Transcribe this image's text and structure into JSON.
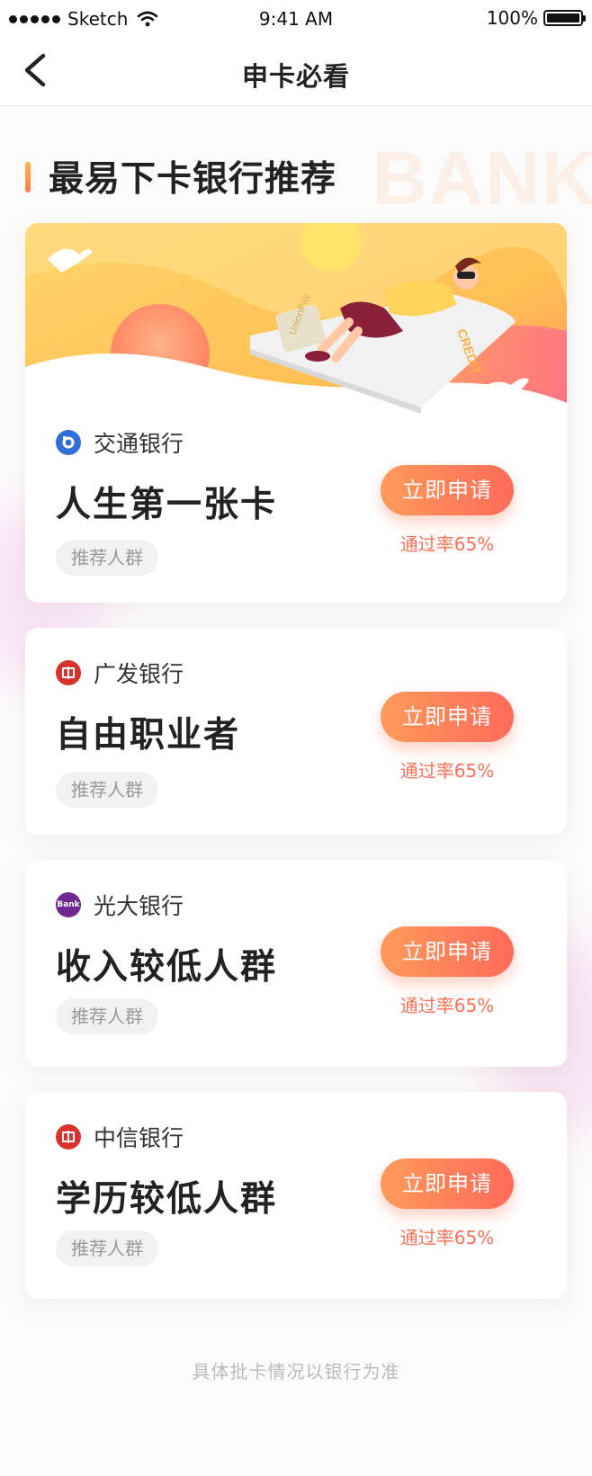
{
  "status_bar": {
    "carrier": "Sketch",
    "time": "9:41 AM",
    "battery": "100%"
  },
  "nav": {
    "title": "申卡必看"
  },
  "section": {
    "title": "最易下卡银行推荐",
    "watermark": "BANK"
  },
  "banner": {
    "card_text": "CREDIT",
    "union_text": "UnionPay"
  },
  "cards": [
    {
      "bank": "交通银行",
      "title": "人生第一张卡",
      "tag": "推荐人群",
      "button": "立即申请",
      "rate": "通过率65%",
      "logo_color": "#2f6fd8"
    },
    {
      "bank": "广发银行",
      "title": "自由职业者",
      "tag": "推荐人群",
      "button": "立即申请",
      "rate": "通过率65%",
      "logo_color": "#d9312b"
    },
    {
      "bank": "光大银行",
      "title": "收入较低人群",
      "tag": "推荐人群",
      "button": "立即申请",
      "rate": "通过率65%",
      "logo_color": "#6e2a8e",
      "logo_text": "Bank"
    },
    {
      "bank": "中信银行",
      "title": "学历较低人群",
      "tag": "推荐人群",
      "button": "立即申请",
      "rate": "通过率65%",
      "logo_color": "#d9312b"
    }
  ],
  "footer": {
    "note": "具体批卡情况以银行为准"
  },
  "colors": {
    "accent": "#ff6f55",
    "button_start": "#ff9a5a",
    "button_end": "#ff6b5a"
  }
}
